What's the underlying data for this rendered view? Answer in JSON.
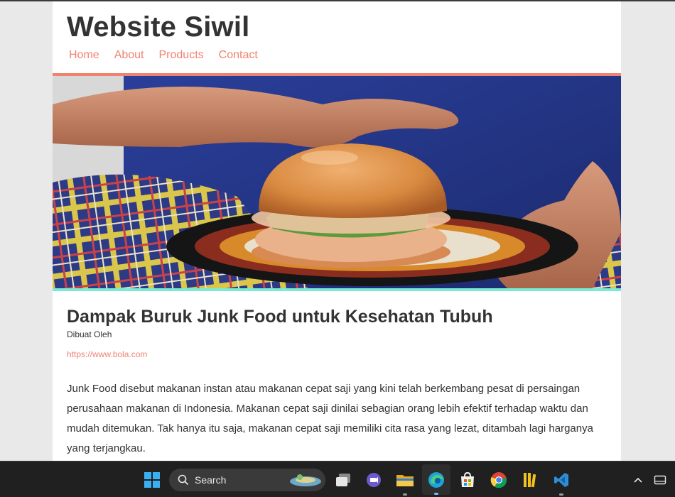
{
  "site": {
    "title": "Website Siwil",
    "nav": [
      "Home",
      "About",
      "Products",
      "Contact"
    ]
  },
  "hero": {
    "icon": "burger-photo"
  },
  "article": {
    "title": "Dampak Buruk Junk Food untuk Kesehatan Tubuh",
    "author_label": "Dibuat Oleh",
    "source": "https://www.bola.com",
    "paragraph": "Junk Food disebut makanan instan atau makanan cepat saji yang kini telah berkembang pesat di persaingan perusahaan makanan di Indonesia. Makanan cepat saji dinilai sebagian orang lebih efektif terhadap waktu dan mudah ditemukan. Tak hanya itu saja, makanan cepat saji memiliki cita rasa yang lezat, ditambah lagi harganya yang terjangkau."
  },
  "taskbar": {
    "search_label": "Search",
    "icons": [
      "windows-start-icon",
      "search-icon",
      "task-view-icon",
      "teams-chat-icon",
      "file-explorer-icon",
      "edge-icon",
      "store-icon",
      "chrome-icon",
      "library-icon",
      "vscode-icon",
      "chevron-up-icon",
      "tray-icon"
    ]
  },
  "colors": {
    "accent": "#f08272",
    "teal": "#79ebd4",
    "text": "#333333",
    "taskbar": "#202020"
  }
}
